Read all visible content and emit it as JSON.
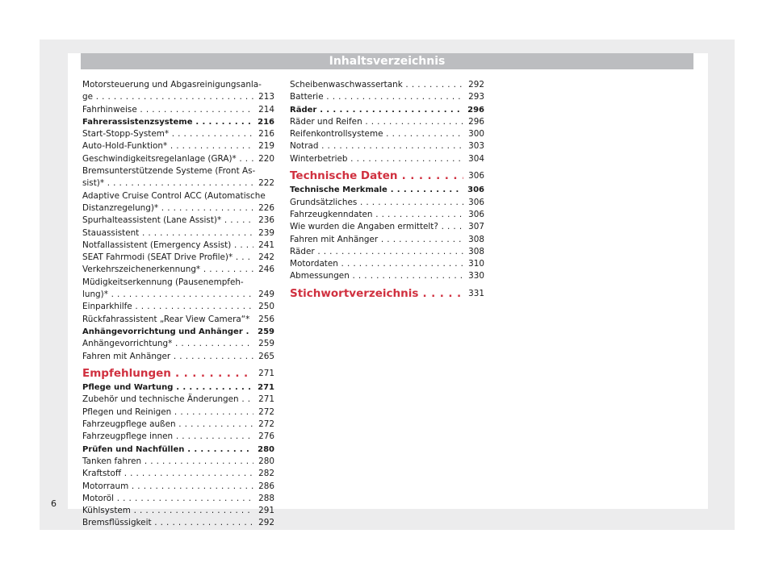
{
  "header": {
    "title": "Inhaltsverzeichnis"
  },
  "page_number": "6",
  "col1": [
    {
      "type": "ml",
      "line1": "Motorsteuerung und Abgasreinigungsanla-",
      "line2": "ge",
      "page": "213"
    },
    {
      "type": "n",
      "text": "Fahrhinweise",
      "page": "214"
    },
    {
      "type": "b",
      "text": "Fahrerassistenzsysteme",
      "page": "216"
    },
    {
      "type": "n",
      "text": "Start-Stopp-System*",
      "page": "216"
    },
    {
      "type": "n",
      "text": "Auto-Hold-Funktion*",
      "page": "219"
    },
    {
      "type": "n",
      "text": "Geschwindigkeitsregelanlage (GRA)*",
      "page": "220"
    },
    {
      "type": "ml",
      "line1": "Bremsunterstützende Systeme (Front As-",
      "line2": "sist)*",
      "page": "222"
    },
    {
      "type": "ml",
      "line1": "Adaptive Cruise Control ACC (Automatische",
      "line2": "Distanzregelung)*",
      "page": "226"
    },
    {
      "type": "n",
      "text": "Spurhalteassistent (Lane Assist)*",
      "page": "236"
    },
    {
      "type": "n",
      "text": "Stauassistent",
      "page": "239"
    },
    {
      "type": "n",
      "text": "Notfallassistent (Emergency Assist)",
      "page": "241"
    },
    {
      "type": "n",
      "text": "SEAT Fahrmodi (SEAT Drive Profile)*",
      "page": "242"
    },
    {
      "type": "n",
      "text": "Verkehrszeichenerkennung*",
      "page": "246"
    },
    {
      "type": "ml",
      "line1": "Müdigkeitserkennung (Pausenempfeh-",
      "line2": "lung)*",
      "page": "249"
    },
    {
      "type": "n",
      "text": "Einparkhilfe",
      "page": "250"
    },
    {
      "type": "n",
      "text": "Rückfahrassistent „Rear View Camera“*",
      "page": "256"
    },
    {
      "type": "b",
      "text": "Anhängevorrichtung und Anhänger",
      "page": "259"
    },
    {
      "type": "n",
      "text": "Anhängevorrichtung*",
      "page": "259"
    },
    {
      "type": "n",
      "text": "Fahren mit Anhänger",
      "page": "265"
    },
    {
      "type": "s",
      "text": "Empfehlungen",
      "page": "271"
    },
    {
      "type": "b",
      "text": "Pflege und Wartung",
      "page": "271"
    },
    {
      "type": "n",
      "text": "Zubehör und technische Änderungen",
      "page": "271"
    },
    {
      "type": "n",
      "text": "Pflegen und Reinigen",
      "page": "272"
    },
    {
      "type": "n",
      "text": "Fahrzeugpflege außen",
      "page": "272"
    },
    {
      "type": "n",
      "text": "Fahrzeugpflege innen",
      "page": "276"
    },
    {
      "type": "b",
      "text": "Prüfen und Nachfüllen",
      "page": "280"
    },
    {
      "type": "n",
      "text": "Tanken fahren",
      "page": "280"
    },
    {
      "type": "n",
      "text": "Kraftstoff",
      "page": "282"
    },
    {
      "type": "n",
      "text": "Motorraum",
      "page": "286"
    },
    {
      "type": "n",
      "text": "Motoröl",
      "page": "288"
    },
    {
      "type": "n",
      "text": "Kühlsystem",
      "page": "291"
    },
    {
      "type": "n",
      "text": "Bremsflüssigkeit",
      "page": "292"
    }
  ],
  "col2": [
    {
      "type": "n",
      "text": "Scheibenwaschwassertank",
      "page": "292"
    },
    {
      "type": "n",
      "text": "Batterie",
      "page": "293"
    },
    {
      "type": "b",
      "text": "Räder",
      "page": "296"
    },
    {
      "type": "n",
      "text": "Räder und Reifen",
      "page": "296"
    },
    {
      "type": "n",
      "text": "Reifenkontrollsysteme",
      "page": "300"
    },
    {
      "type": "n",
      "text": "Notrad",
      "page": "303"
    },
    {
      "type": "n",
      "text": "Winterbetrieb",
      "page": "304"
    },
    {
      "type": "s",
      "text": "Technische Daten",
      "page": "306"
    },
    {
      "type": "b",
      "text": "Technische Merkmale",
      "page": "306"
    },
    {
      "type": "n",
      "text": "Grundsätzliches",
      "page": "306"
    },
    {
      "type": "n",
      "text": "Fahrzeugkenndaten",
      "page": "306"
    },
    {
      "type": "n",
      "text": "Wie wurden die Angaben ermittelt?",
      "page": "307"
    },
    {
      "type": "n",
      "text": "Fahren mit Anhänger",
      "page": "308"
    },
    {
      "type": "n",
      "text": "Räder",
      "page": "308"
    },
    {
      "type": "n",
      "text": "Motordaten",
      "page": "310"
    },
    {
      "type": "n",
      "text": "Abmessungen",
      "page": "330"
    },
    {
      "type": "s",
      "text": "Stichwortverzeichnis",
      "page": "331"
    }
  ]
}
